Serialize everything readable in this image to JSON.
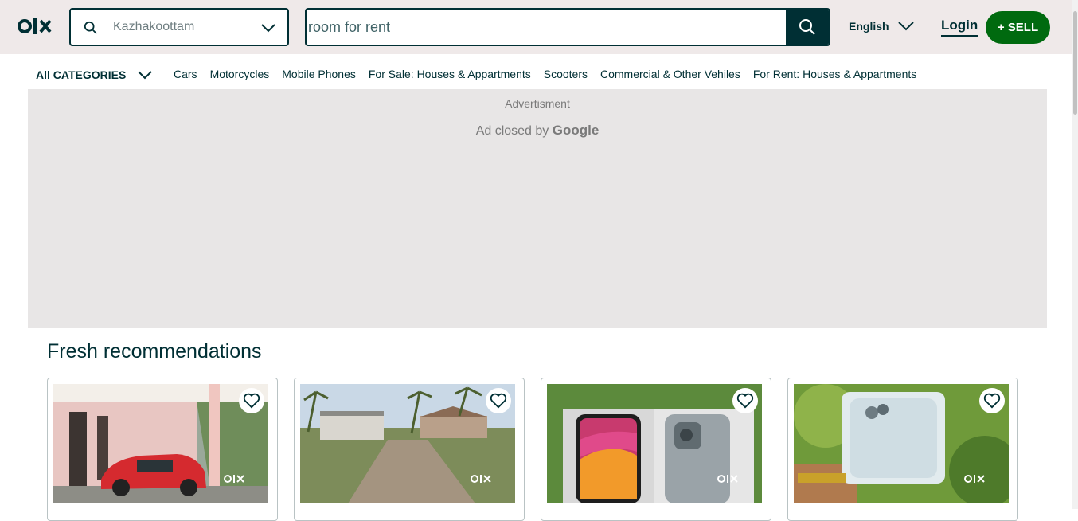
{
  "header": {
    "logo_text": "OLX",
    "location": {
      "value": "Kazhakoottam"
    },
    "search": {
      "value": "room for rent",
      "placeholder": "room for rent"
    },
    "language": "English",
    "login": "Login",
    "sell": "+ SELL"
  },
  "categories": {
    "all_label": "All CATEGORIES",
    "links": [
      "Cars",
      "Motorcycles",
      "Mobile Phones",
      "For Sale: Houses & Appartments",
      "Scooters",
      "Commercial & Other Vehiles",
      "For Rent: Houses & Appartments"
    ]
  },
  "ad": {
    "label": "Advertisment",
    "closed_prefix": "Ad closed by",
    "closed_brand": "Google"
  },
  "recommendations": {
    "title": "Fresh recommendations",
    "cards": [
      {
        "image": "red-car-under-porch"
      },
      {
        "image": "road-with-houses-and-palms"
      },
      {
        "image": "iphone-in-box-on-grass"
      },
      {
        "image": "hand-holding-white-iphone"
      }
    ]
  },
  "colors": {
    "brand_dark": "#002f34",
    "sell_green": "#006a0f",
    "header_bg": "#efe9e9",
    "ad_bg": "#e8e6e6"
  }
}
